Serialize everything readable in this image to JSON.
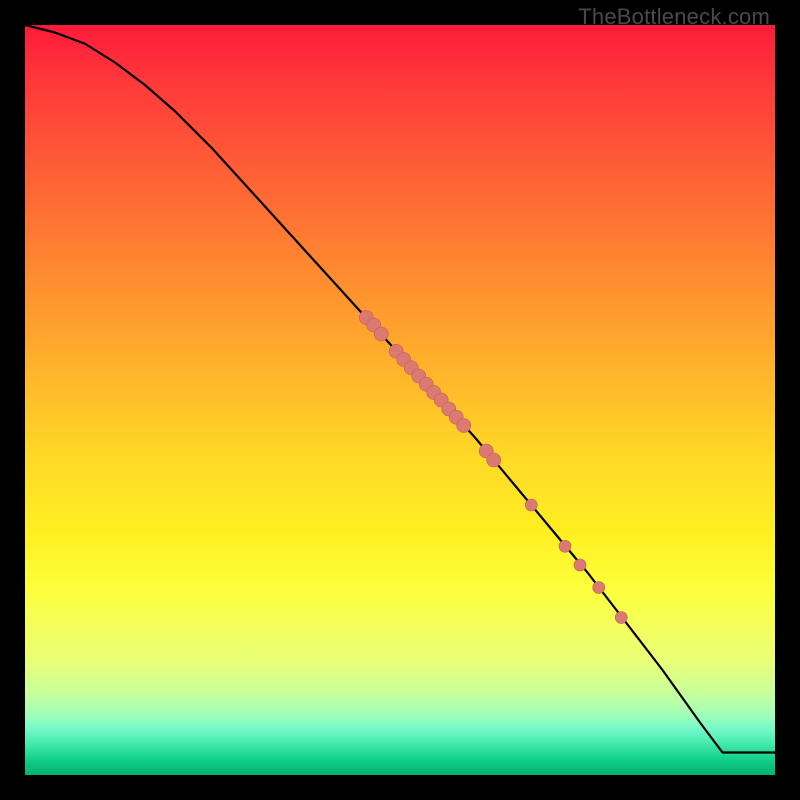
{
  "watermark": "TheBottleneck.com",
  "colors": {
    "background": "#000000",
    "curve": "#000000",
    "dot_fill": "#db7a72",
    "dot_stroke": "#c25a52"
  },
  "chart_data": {
    "type": "line",
    "title": "",
    "xlabel": "",
    "ylabel": "",
    "xlim": [
      0,
      100
    ],
    "ylim": [
      0,
      100
    ],
    "grid": false,
    "legend": false,
    "series": [
      {
        "name": "curve",
        "x": [
          0,
          4,
          8,
          12,
          16,
          20,
          25,
          30,
          35,
          40,
          45,
          50,
          55,
          60,
          65,
          70,
          75,
          80,
          85,
          90,
          93,
          100
        ],
        "y": [
          100,
          99,
          97.5,
          95,
          92,
          88.5,
          83.5,
          78,
          72.5,
          67,
          61.5,
          56,
          50.5,
          45,
          39,
          33,
          27,
          20.5,
          14,
          7,
          3,
          3
        ]
      }
    ],
    "points": [
      {
        "x": 45.5,
        "y": 61.0,
        "r": 7
      },
      {
        "x": 46.5,
        "y": 60.0,
        "r": 7
      },
      {
        "x": 47.5,
        "y": 58.8,
        "r": 7
      },
      {
        "x": 49.5,
        "y": 56.5,
        "r": 7
      },
      {
        "x": 50.5,
        "y": 55.4,
        "r": 7
      },
      {
        "x": 51.5,
        "y": 54.3,
        "r": 7
      },
      {
        "x": 52.5,
        "y": 53.2,
        "r": 7
      },
      {
        "x": 53.5,
        "y": 52.1,
        "r": 7
      },
      {
        "x": 54.5,
        "y": 51.0,
        "r": 7
      },
      {
        "x": 55.5,
        "y": 50.0,
        "r": 7
      },
      {
        "x": 56.5,
        "y": 48.8,
        "r": 7
      },
      {
        "x": 57.5,
        "y": 47.7,
        "r": 7
      },
      {
        "x": 58.5,
        "y": 46.6,
        "r": 7
      },
      {
        "x": 61.5,
        "y": 43.2,
        "r": 7
      },
      {
        "x": 62.5,
        "y": 42.0,
        "r": 7
      },
      {
        "x": 67.5,
        "y": 36.0,
        "r": 6
      },
      {
        "x": 72.0,
        "y": 30.5,
        "r": 6
      },
      {
        "x": 74.0,
        "y": 28.0,
        "r": 6
      },
      {
        "x": 76.5,
        "y": 25.0,
        "r": 6
      },
      {
        "x": 79.5,
        "y": 21.0,
        "r": 6
      }
    ]
  }
}
